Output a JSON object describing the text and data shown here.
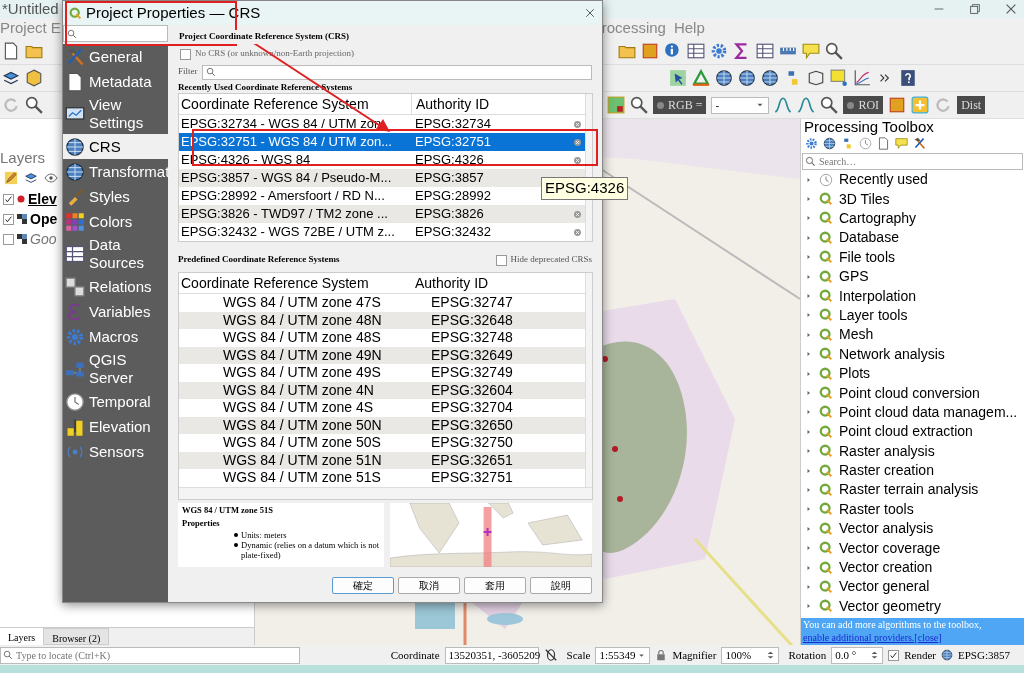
{
  "main_window": {
    "title": "*Untitled",
    "menu": [
      "Project",
      "E",
      "rocessing",
      "Help"
    ]
  },
  "toolbar": {
    "rgb_label": "RGB =",
    "band_value": "-",
    "roi_label": "ROI",
    "dist_label": "Dist"
  },
  "layers_panel": {
    "title": "Layers",
    "layers": [
      {
        "name": "Elev",
        "checked": true,
        "selected": true,
        "kind": "point"
      },
      {
        "name": "Ope",
        "checked": true,
        "selected": false,
        "kind": "raster"
      },
      {
        "name": "Goo",
        "checked": false,
        "selected": false,
        "kind": "raster"
      }
    ],
    "tabs": [
      {
        "label": "Layers",
        "selected": true
      },
      {
        "label": "Browser (2)",
        "selected": false
      }
    ],
    "locate_placeholder": "Type to locate (Ctrl+K)"
  },
  "dialog": {
    "title": "Project Properties — CRS",
    "sections": [
      {
        "label": "General",
        "selected": false
      },
      {
        "label": "Metadata",
        "selected": false
      },
      {
        "label": "View Settings",
        "selected": false
      },
      {
        "label": "CRS",
        "selected": true
      },
      {
        "label": "Transformat",
        "selected": false
      },
      {
        "label": "Styles",
        "selected": false
      },
      {
        "label": "Colors",
        "selected": false
      },
      {
        "label": "Data Sources",
        "selected": false
      },
      {
        "label": "Relations",
        "selected": false
      },
      {
        "label": "Variables",
        "selected": false
      },
      {
        "label": "Macros",
        "selected": false
      },
      {
        "label": "QGIS Server",
        "selected": false
      },
      {
        "label": "Temporal",
        "selected": false
      },
      {
        "label": "Elevation",
        "selected": false
      },
      {
        "label": "Sensors",
        "selected": false
      }
    ],
    "heading": "Project Coordinate Reference System (CRS)",
    "no_crs": {
      "label": "No CRS (or unknown/non-Earth projection)",
      "checked": false
    },
    "filter_label": "Filter",
    "recent": {
      "title": "Recently Used Coordinate Reference Systems",
      "columns": [
        "Coordinate Reference System",
        "Authority ID"
      ],
      "rows": [
        {
          "crs": "EPSG:32734 - WGS 84 / UTM zon",
          "authority_id": "EPSG:32734",
          "selected": false
        },
        {
          "crs": "EPSG:32751 - WGS 84 / UTM zon...",
          "authority_id": "EPSG:32751",
          "selected": true
        },
        {
          "crs": "EPSG:4326 - WGS 84",
          "authority_id": "EPSG:4326",
          "selected": false
        },
        {
          "crs": "EPSG:3857 - WGS 84 / Pseudo-M...",
          "authority_id": "EPSG:3857",
          "selected": false
        },
        {
          "crs": "EPSG:28992 - Amersfoort / RD N...",
          "authority_id": "EPSG:28992",
          "selected": false
        },
        {
          "crs": "EPSG:3826 - TWD97 / TM2 zone ...",
          "authority_id": "EPSG:3826",
          "selected": false
        },
        {
          "crs": "EPSG:32432 - WGS 72BE / UTM z...",
          "authority_id": "EPSG:32432",
          "selected": false
        }
      ]
    },
    "predefined": {
      "title": "Predefined Coordinate Reference Systems",
      "hide_deprecated": {
        "label": "Hide deprecated CRSs",
        "checked": false
      },
      "columns": [
        "Coordinate Reference System",
        "Authority ID"
      ],
      "rows": [
        {
          "crs": "WGS 84 / UTM zone 47S",
          "authority_id": "EPSG:32747"
        },
        {
          "crs": "WGS 84 / UTM zone 48N",
          "authority_id": "EPSG:32648"
        },
        {
          "crs": "WGS 84 / UTM zone 48S",
          "authority_id": "EPSG:32748"
        },
        {
          "crs": "WGS 84 / UTM zone 49N",
          "authority_id": "EPSG:32649"
        },
        {
          "crs": "WGS 84 / UTM zone 49S",
          "authority_id": "EPSG:32749"
        },
        {
          "crs": "WGS 84 / UTM zone 4N",
          "authority_id": "EPSG:32604"
        },
        {
          "crs": "WGS 84 / UTM zone 4S",
          "authority_id": "EPSG:32704"
        },
        {
          "crs": "WGS 84 / UTM zone 50N",
          "authority_id": "EPSG:32650"
        },
        {
          "crs": "WGS 84 / UTM zone 50S",
          "authority_id": "EPSG:32750"
        },
        {
          "crs": "WGS 84 / UTM zone 51N",
          "authority_id": "EPSG:32651"
        },
        {
          "crs": "WGS 84 / UTM zone 51S",
          "authority_id": "EPSG:32751"
        }
      ]
    },
    "details": {
      "name": "WGS 84 / UTM zone 51S",
      "properties_title": "Properties",
      "bullets": [
        "Units: meters",
        "Dynamic (relies on a datum which is not plate-fixed)"
      ]
    },
    "buttons": [
      "確定",
      "取消",
      "套用",
      "說明"
    ]
  },
  "tooltip": "EPSG:4326",
  "toolbox": {
    "title": "Processing Toolbox",
    "search_placeholder": "Search…",
    "groups": [
      {
        "label": "Recently used",
        "kind": "recent"
      },
      {
        "label": "3D Tiles",
        "kind": "provider"
      },
      {
        "label": "Cartography",
        "kind": "provider"
      },
      {
        "label": "Database",
        "kind": "provider"
      },
      {
        "label": "File tools",
        "kind": "provider"
      },
      {
        "label": "GPS",
        "kind": "provider"
      },
      {
        "label": "Interpolation",
        "kind": "provider"
      },
      {
        "label": "Layer tools",
        "kind": "provider"
      },
      {
        "label": "Mesh",
        "kind": "provider"
      },
      {
        "label": "Network analysis",
        "kind": "provider"
      },
      {
        "label": "Plots",
        "kind": "provider"
      },
      {
        "label": "Point cloud conversion",
        "kind": "provider"
      },
      {
        "label": "Point cloud data managem...",
        "kind": "provider"
      },
      {
        "label": "Point cloud extraction",
        "kind": "provider"
      },
      {
        "label": "Raster analysis",
        "kind": "provider"
      },
      {
        "label": "Raster creation",
        "kind": "provider"
      },
      {
        "label": "Raster terrain analysis",
        "kind": "provider"
      },
      {
        "label": "Raster tools",
        "kind": "provider"
      },
      {
        "label": "Vector analysis",
        "kind": "provider"
      },
      {
        "label": "Vector coverage",
        "kind": "provider"
      },
      {
        "label": "Vector creation",
        "kind": "provider"
      },
      {
        "label": "Vector general",
        "kind": "provider"
      },
      {
        "label": "Vector geometry",
        "kind": "provider"
      }
    ],
    "info": {
      "text": "You can add more algorithms to the toolbox, ",
      "link": "enable additional providers.",
      "close": "[close]"
    }
  },
  "status_bar": {
    "coordinate_label": "Coordinate",
    "coordinate": "13520351, -3605209",
    "scale_label": "Scale",
    "scale": "1:55349",
    "magnifier_label": "Magnifier",
    "magnifier": "100%",
    "rotation_label": "Rotation",
    "rotation": "0.0 °",
    "render": {
      "label": "Render",
      "checked": true
    },
    "crs": "EPSG:3857"
  }
}
